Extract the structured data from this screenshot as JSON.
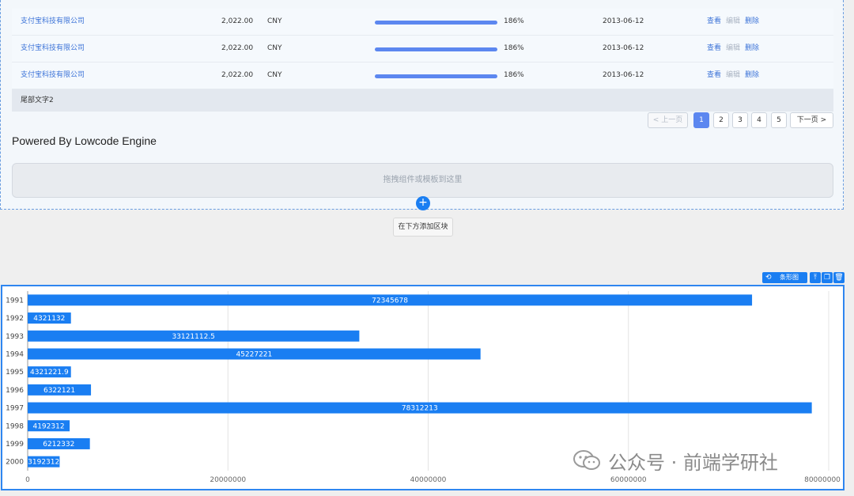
{
  "table": {
    "rows": [
      {
        "name": "支付宝科技有限公司",
        "amount": "2,022.00",
        "currency": "CNY",
        "progress_pct": "186%",
        "progress": 1.0,
        "date": "2013-06-12",
        "actions": [
          "查看",
          "编辑",
          "删除"
        ]
      },
      {
        "name": "支付宝科技有限公司",
        "amount": "2,022.00",
        "currency": "CNY",
        "progress_pct": "186%",
        "progress": 1.0,
        "date": "2013-06-12",
        "actions": [
          "查看",
          "编辑",
          "删除"
        ]
      },
      {
        "name": "支付宝科技有限公司",
        "amount": "2,022.00",
        "currency": "CNY",
        "progress_pct": "186%",
        "progress": 1.0,
        "date": "2013-06-12",
        "actions": [
          "查看",
          "编辑",
          "删除"
        ]
      }
    ],
    "footer": "尾部文字2"
  },
  "pagination": {
    "prev": "< 上一页",
    "next": "下一页 >",
    "pages": [
      "1",
      "2",
      "3",
      "4",
      "5"
    ],
    "current": "1"
  },
  "section": {
    "title": "Powered By Lowcode Engine",
    "dropzone": "拖拽组件或模板到这里",
    "plus": "+",
    "add_block": "在下方添加区块"
  },
  "chart_toolbar": {
    "label": "条形图",
    "icons": [
      "component-icon",
      "move-up-icon",
      "copy-icon",
      "delete-icon"
    ]
  },
  "chart_data": {
    "type": "bar",
    "orientation": "horizontal",
    "categories": [
      "1991",
      "1992",
      "1993",
      "1994",
      "1995",
      "1996",
      "1997",
      "1998",
      "1999",
      "2000"
    ],
    "values": [
      72345678,
      4321132,
      33121112.5,
      45227221,
      4321221.9,
      6322121,
      78312213,
      4192312,
      6212332,
      3192312
    ],
    "value_labels": [
      "72345678",
      "4321132",
      "33121112.5",
      "45227221",
      "4321221.9",
      "6322121",
      "78312213",
      "4192312",
      "6212332",
      "3192312"
    ],
    "x_ticks": [
      "0",
      "20000000",
      "40000000",
      "60000000",
      "80000000"
    ],
    "xlim": [
      0,
      80000000
    ],
    "grid": true,
    "color": "#1a7ef2"
  },
  "watermark": {
    "text": "公众号 · 前端学研社"
  }
}
